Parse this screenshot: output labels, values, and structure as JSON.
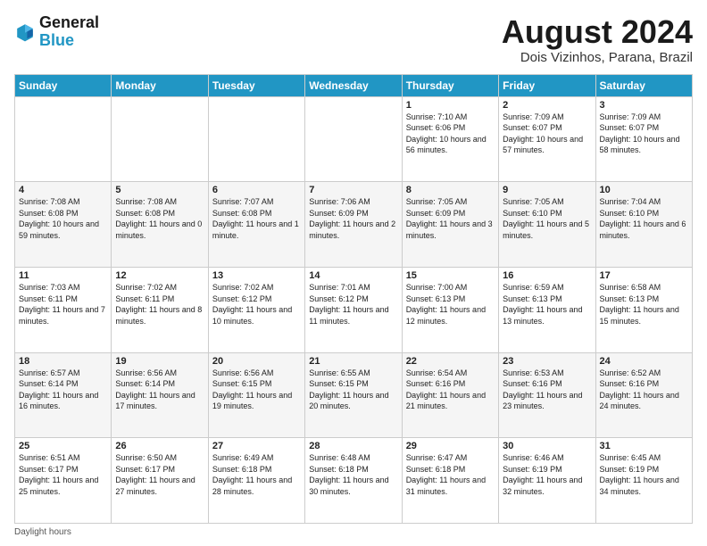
{
  "logo": {
    "line1": "General",
    "line2": "Blue"
  },
  "title": "August 2024",
  "location": "Dois Vizinhos, Parana, Brazil",
  "days_of_week": [
    "Sunday",
    "Monday",
    "Tuesday",
    "Wednesday",
    "Thursday",
    "Friday",
    "Saturday"
  ],
  "footer": "Daylight hours",
  "weeks": [
    [
      {
        "day": "",
        "info": ""
      },
      {
        "day": "",
        "info": ""
      },
      {
        "day": "",
        "info": ""
      },
      {
        "day": "",
        "info": ""
      },
      {
        "day": "1",
        "info": "Sunrise: 7:10 AM\nSunset: 6:06 PM\nDaylight: 10 hours\nand 56 minutes."
      },
      {
        "day": "2",
        "info": "Sunrise: 7:09 AM\nSunset: 6:07 PM\nDaylight: 10 hours\nand 57 minutes."
      },
      {
        "day": "3",
        "info": "Sunrise: 7:09 AM\nSunset: 6:07 PM\nDaylight: 10 hours\nand 58 minutes."
      }
    ],
    [
      {
        "day": "4",
        "info": "Sunrise: 7:08 AM\nSunset: 6:08 PM\nDaylight: 10 hours\nand 59 minutes."
      },
      {
        "day": "5",
        "info": "Sunrise: 7:08 AM\nSunset: 6:08 PM\nDaylight: 11 hours\nand 0 minutes."
      },
      {
        "day": "6",
        "info": "Sunrise: 7:07 AM\nSunset: 6:08 PM\nDaylight: 11 hours\nand 1 minute."
      },
      {
        "day": "7",
        "info": "Sunrise: 7:06 AM\nSunset: 6:09 PM\nDaylight: 11 hours\nand 2 minutes."
      },
      {
        "day": "8",
        "info": "Sunrise: 7:05 AM\nSunset: 6:09 PM\nDaylight: 11 hours\nand 3 minutes."
      },
      {
        "day": "9",
        "info": "Sunrise: 7:05 AM\nSunset: 6:10 PM\nDaylight: 11 hours\nand 5 minutes."
      },
      {
        "day": "10",
        "info": "Sunrise: 7:04 AM\nSunset: 6:10 PM\nDaylight: 11 hours\nand 6 minutes."
      }
    ],
    [
      {
        "day": "11",
        "info": "Sunrise: 7:03 AM\nSunset: 6:11 PM\nDaylight: 11 hours\nand 7 minutes."
      },
      {
        "day": "12",
        "info": "Sunrise: 7:02 AM\nSunset: 6:11 PM\nDaylight: 11 hours\nand 8 minutes."
      },
      {
        "day": "13",
        "info": "Sunrise: 7:02 AM\nSunset: 6:12 PM\nDaylight: 11 hours\nand 10 minutes."
      },
      {
        "day": "14",
        "info": "Sunrise: 7:01 AM\nSunset: 6:12 PM\nDaylight: 11 hours\nand 11 minutes."
      },
      {
        "day": "15",
        "info": "Sunrise: 7:00 AM\nSunset: 6:13 PM\nDaylight: 11 hours\nand 12 minutes."
      },
      {
        "day": "16",
        "info": "Sunrise: 6:59 AM\nSunset: 6:13 PM\nDaylight: 11 hours\nand 13 minutes."
      },
      {
        "day": "17",
        "info": "Sunrise: 6:58 AM\nSunset: 6:13 PM\nDaylight: 11 hours\nand 15 minutes."
      }
    ],
    [
      {
        "day": "18",
        "info": "Sunrise: 6:57 AM\nSunset: 6:14 PM\nDaylight: 11 hours\nand 16 minutes."
      },
      {
        "day": "19",
        "info": "Sunrise: 6:56 AM\nSunset: 6:14 PM\nDaylight: 11 hours\nand 17 minutes."
      },
      {
        "day": "20",
        "info": "Sunrise: 6:56 AM\nSunset: 6:15 PM\nDaylight: 11 hours\nand 19 minutes."
      },
      {
        "day": "21",
        "info": "Sunrise: 6:55 AM\nSunset: 6:15 PM\nDaylight: 11 hours\nand 20 minutes."
      },
      {
        "day": "22",
        "info": "Sunrise: 6:54 AM\nSunset: 6:16 PM\nDaylight: 11 hours\nand 21 minutes."
      },
      {
        "day": "23",
        "info": "Sunrise: 6:53 AM\nSunset: 6:16 PM\nDaylight: 11 hours\nand 23 minutes."
      },
      {
        "day": "24",
        "info": "Sunrise: 6:52 AM\nSunset: 6:16 PM\nDaylight: 11 hours\nand 24 minutes."
      }
    ],
    [
      {
        "day": "25",
        "info": "Sunrise: 6:51 AM\nSunset: 6:17 PM\nDaylight: 11 hours\nand 25 minutes."
      },
      {
        "day": "26",
        "info": "Sunrise: 6:50 AM\nSunset: 6:17 PM\nDaylight: 11 hours\nand 27 minutes."
      },
      {
        "day": "27",
        "info": "Sunrise: 6:49 AM\nSunset: 6:18 PM\nDaylight: 11 hours\nand 28 minutes."
      },
      {
        "day": "28",
        "info": "Sunrise: 6:48 AM\nSunset: 6:18 PM\nDaylight: 11 hours\nand 30 minutes."
      },
      {
        "day": "29",
        "info": "Sunrise: 6:47 AM\nSunset: 6:18 PM\nDaylight: 11 hours\nand 31 minutes."
      },
      {
        "day": "30",
        "info": "Sunrise: 6:46 AM\nSunset: 6:19 PM\nDaylight: 11 hours\nand 32 minutes."
      },
      {
        "day": "31",
        "info": "Sunrise: 6:45 AM\nSunset: 6:19 PM\nDaylight: 11 hours\nand 34 minutes."
      }
    ]
  ]
}
